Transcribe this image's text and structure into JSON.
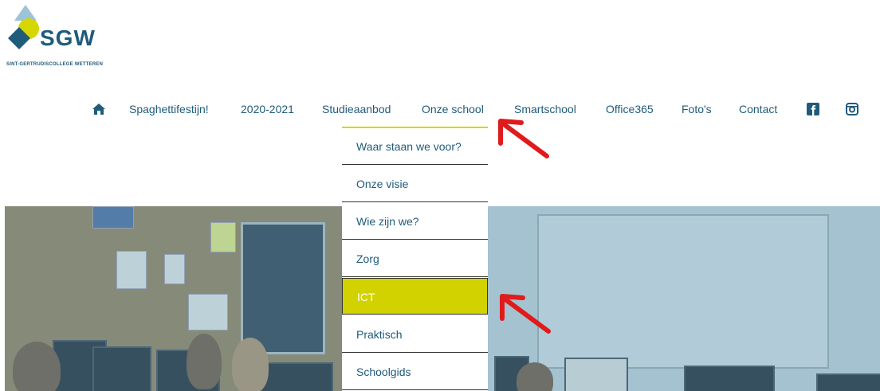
{
  "logo": {
    "text": "SGW",
    "subtitle": "SINT-GERTRUDISCOLLEGE WETTEREN",
    "colors": {
      "blue": "#1f5b7a",
      "yellow": "#d6d600",
      "light_blue": "#9cc3d8"
    }
  },
  "nav": {
    "items": [
      {
        "label": "Spaghettifestijn!"
      },
      {
        "label": "2020-2021"
      },
      {
        "label": "Studieaanbod"
      },
      {
        "label": "Onze school"
      },
      {
        "label": "Smartschool"
      },
      {
        "label": "Office365"
      },
      {
        "label": "Foto's"
      },
      {
        "label": "Contact"
      }
    ],
    "home_icon": "home-icon",
    "social_icons": [
      "facebook-icon",
      "instagram-icon"
    ],
    "active": "Onze school"
  },
  "dropdown": {
    "items": [
      {
        "label": "Waar staan we voor?"
      },
      {
        "label": "Onze visie"
      },
      {
        "label": "Wie zijn we?"
      },
      {
        "label": "Zorg"
      },
      {
        "label": "ICT"
      },
      {
        "label": "Praktisch"
      },
      {
        "label": "Schoolgids"
      }
    ],
    "active": "ICT",
    "active_color": "#d2d200"
  },
  "annotations": {
    "arrow_color": "#e01b1b"
  }
}
